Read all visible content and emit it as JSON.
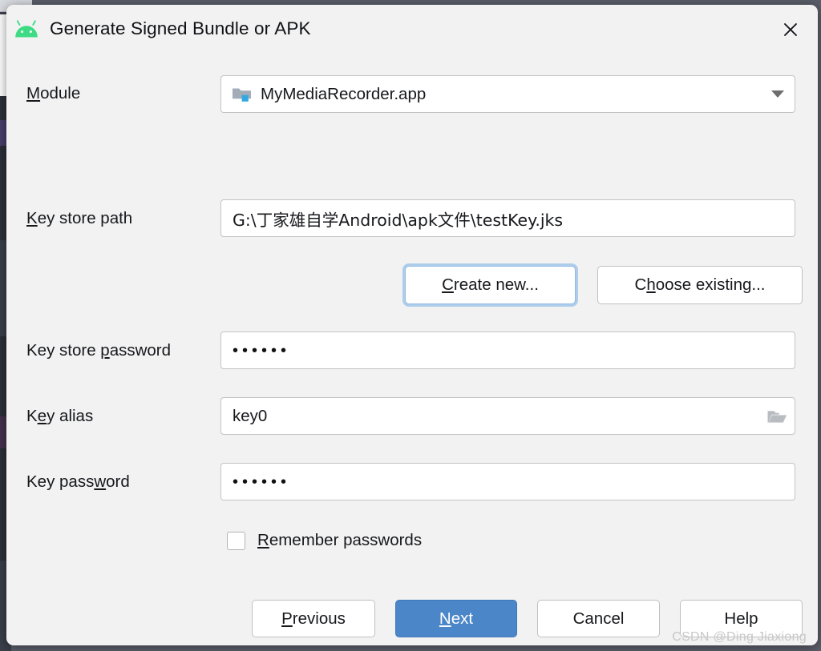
{
  "window": {
    "title": "Generate Signed Bundle or APK",
    "app_icon": "android-robot-icon",
    "close_icon": "close-icon"
  },
  "form": {
    "module": {
      "label_pre": "M",
      "label_post": "odule",
      "value": "MyMediaRecorder.app",
      "icon": "module-folder-icon",
      "dropdown_icon": "chevron-down-icon"
    },
    "keystore_path": {
      "label_pre": "K",
      "label_post": "ey store path",
      "value": "G:\\丁家雄自学Android\\apk文件\\testKey.jks"
    },
    "keystore_password": {
      "label_a": "Key store ",
      "label_mn": "p",
      "label_b": "assword",
      "value": "••••••"
    },
    "key_alias": {
      "label_a": "K",
      "label_mn": "e",
      "label_b": "y alias",
      "value": "key0",
      "browse_icon": "folder-open-icon"
    },
    "key_password": {
      "label_a": "Key pass",
      "label_mn": "w",
      "label_b": "ord",
      "value": "••••••"
    },
    "remember_passwords": {
      "label_mn": "R",
      "label_post": "emember passwords",
      "checked": false
    }
  },
  "keystore_buttons": {
    "create_new": {
      "mn": "C",
      "rest": "reate new...",
      "focused": true
    },
    "choose_existing": {
      "pre": "C",
      "mn": "h",
      "rest": "oose existing..."
    }
  },
  "footer_buttons": {
    "previous": {
      "mn": "P",
      "rest": "revious"
    },
    "next": {
      "mn": "N",
      "rest": "ext",
      "is_default": true
    },
    "cancel": {
      "label": "Cancel"
    },
    "help": {
      "label": "Help"
    }
  },
  "watermark": {
    "text": "CSDN @Ding Jiaxiong"
  },
  "colors": {
    "dialog_bg": "#f2f2f2",
    "accent_blue": "#4a86c8",
    "focus_ring": "#adcdeb",
    "android_green": "#3ddc84",
    "field_white": "#ffffff",
    "field_border": "#c3c3c3"
  }
}
